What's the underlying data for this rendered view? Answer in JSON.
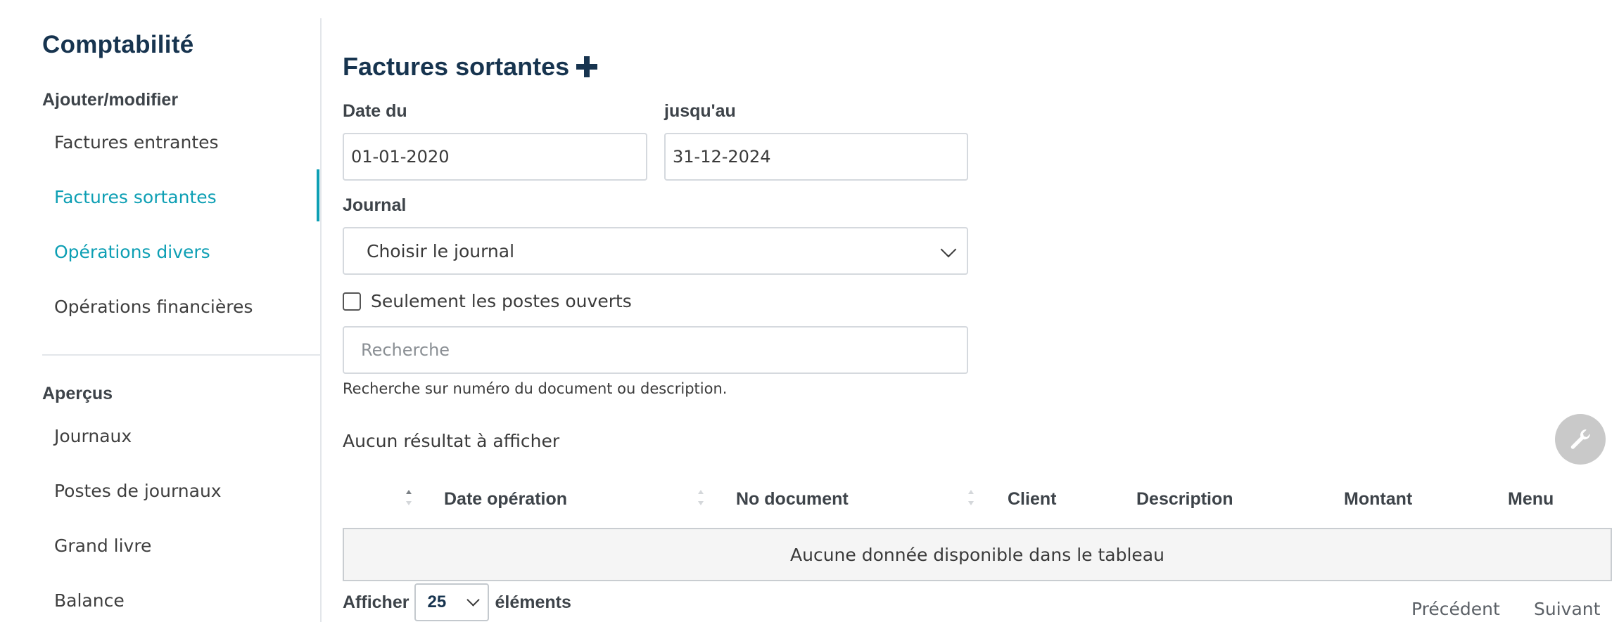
{
  "sidebar": {
    "title": "Comptabilité",
    "section_add": "Ajouter/modifier",
    "add_items": [
      {
        "label": "Factures entrantes"
      },
      {
        "label": "Factures sortantes"
      },
      {
        "label": "Opérations divers"
      },
      {
        "label": "Opérations financières"
      }
    ],
    "section_overview": "Aperçus",
    "overview_items": [
      {
        "label": "Journaux"
      },
      {
        "label": "Postes de journaux"
      },
      {
        "label": "Grand livre"
      },
      {
        "label": "Balance"
      }
    ],
    "active_item": "Factures sortantes"
  },
  "main": {
    "title": "Factures sortantes",
    "date_from_label": "Date du",
    "date_from_value": "01-01-2020",
    "date_to_label": "jusqu'au",
    "date_to_value": "31-12-2024",
    "journal_label": "Journal",
    "journal_selected": "Choisir le journal",
    "open_items_label": "Seulement les postes ouverts",
    "search_placeholder": "Recherche",
    "search_help": "Recherche sur numéro du document ou description.",
    "no_results": "Aucun résultat à afficher"
  },
  "table": {
    "columns": [
      "Date opération",
      "No document",
      "Client",
      "Description",
      "Montant",
      "Menu"
    ],
    "empty_text": "Aucune donnée disponible dans le tableau",
    "length_prefix": "Afficher",
    "length_value": "25",
    "length_suffix": "éléments",
    "previous": "Précédent",
    "next": "Suivant"
  },
  "colors": {
    "brand_navy": "#17344f",
    "accent_teal": "#0d9fb4",
    "wrench_button": "#c9c9c9"
  },
  "icons": {
    "add": "plus-icon",
    "journal_dropdown": "chevron-down-icon",
    "settings": "wrench-icon",
    "sort": "sort-icon"
  }
}
